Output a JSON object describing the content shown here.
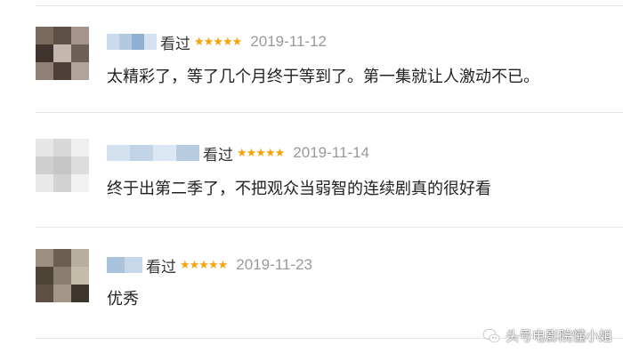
{
  "comments": [
    {
      "watched": "看过",
      "stars": "★★★★★",
      "date": "2019-11-12",
      "text": "太精彩了，等了几个月终于等到了。第一集就让人激动不已。",
      "avatar_colors": [
        "#7a6a5e",
        "#5e4f45",
        "#a49489",
        "#3f342d",
        "#c2b6ad",
        "#6e5f55",
        "#8f7f74",
        "#4b3f38",
        "#b1a39a"
      ]
    },
    {
      "watched": "看过",
      "stars": "★★★★★",
      "date": "2019-11-14",
      "text": "终于出第二季了，不把观众当弱智的连续剧真的很好看",
      "avatar_colors": [
        "#e6e6e6",
        "#d8d8d8",
        "#efefef",
        "#cfcfcf",
        "#c6c6c6",
        "#dcdcdc",
        "#e9e9e9",
        "#d2d2d2",
        "#f1f1f1"
      ]
    },
    {
      "watched": "看过",
      "stars": "★★★★★",
      "date": "2019-11-23",
      "text": "优秀",
      "avatar_colors": [
        "#9b8f7f",
        "#6b5f52",
        "#b8ae9f",
        "#4d4337",
        "#8a7e6e",
        "#c4bba9",
        "#5c5144",
        "#a39787",
        "#3e352c"
      ]
    }
  ],
  "watermark": {
    "icon": "wechat-icon",
    "text": "头号电影院懂小姐"
  },
  "colors": {
    "star": "#f4a30a",
    "date": "#999999",
    "divider": "#e6e6e6",
    "username_blur": "#c5d7ea"
  }
}
